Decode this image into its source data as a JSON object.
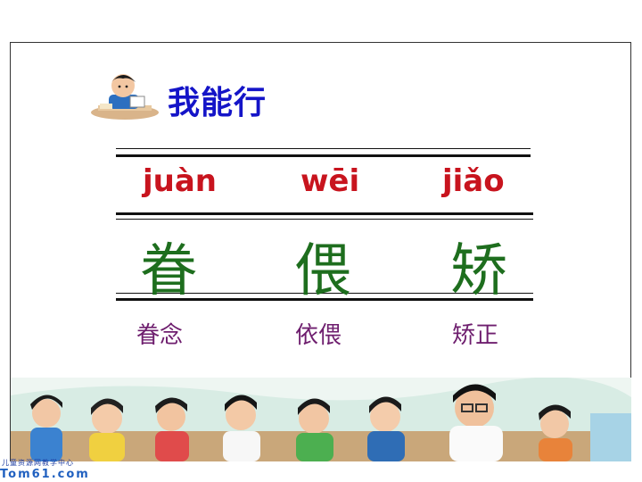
{
  "heading": {
    "title": "我能行",
    "mascot_icon": "boy-reading-icon"
  },
  "rows": {
    "pinyin": [
      "juàn",
      "wēi",
      "jiǎo"
    ],
    "characters": [
      "眷",
      "偎",
      "矫"
    ],
    "words": [
      "眷念",
      "依偎",
      "矫正"
    ]
  },
  "colors": {
    "title": "#1414c8",
    "pinyin": "#c8141e",
    "characters": "#1e6e1e",
    "words": "#6e1e6e"
  },
  "logo": {
    "caption": "儿童资源网教学中心",
    "mark": "Tom61.com"
  }
}
